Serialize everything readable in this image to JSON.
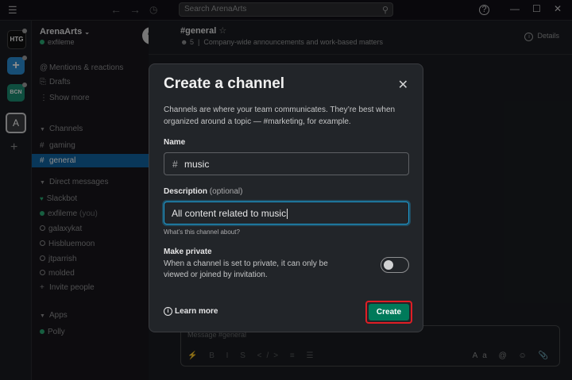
{
  "topbar": {
    "search_placeholder": "Search ArenaArts"
  },
  "rail": {
    "workspaces": [
      {
        "label": "HTG"
      },
      {
        "label": "+"
      },
      {
        "label": "BCN"
      },
      {
        "label": "A"
      }
    ],
    "add_label": "+"
  },
  "sidebar": {
    "workspace_name": "ArenaArts",
    "user_name": "exfileme",
    "mentions": "Mentions & reactions",
    "drafts": "Drafts",
    "show_more": "Show more",
    "channels_header": "Channels",
    "channels": [
      {
        "name": "gaming"
      },
      {
        "name": "general"
      }
    ],
    "dm_header": "Direct messages",
    "dms": [
      {
        "name": "Slackbot"
      },
      {
        "name": "exfileme",
        "suffix": "(you)"
      },
      {
        "name": "galaxykat"
      },
      {
        "name": "Hisbluemoon"
      },
      {
        "name": "jtparrish"
      },
      {
        "name": "molded"
      }
    ],
    "invite": "Invite people",
    "apps_header": "Apps",
    "apps": [
      {
        "name": "Polly"
      }
    ]
  },
  "channel": {
    "title": "#general",
    "member_count": "5",
    "topic": "Company-wide announcements and work-based matters",
    "details_label": "Details",
    "message_placeholder": "Message #general"
  },
  "modal": {
    "title": "Create a channel",
    "description": "Channels are where your team communicates. They’re best when organized around a topic — #marketing, for example.",
    "name_label": "Name",
    "name_value": "music",
    "description_label": "Description",
    "description_optional": "(optional)",
    "description_value": "All content related to music",
    "description_hint": "What’s this channel about?",
    "private_label": "Make private",
    "private_description": "When a channel is set to private, it can only be viewed or joined by invitation.",
    "private_on": false,
    "learn_more": "Learn more",
    "create_label": "Create"
  },
  "colors": {
    "accent": "#1164a3",
    "create_button": "#007a5a",
    "highlight_border": "#e01e25",
    "focus_ring": "#1d9bd1",
    "online": "#2bac76"
  }
}
